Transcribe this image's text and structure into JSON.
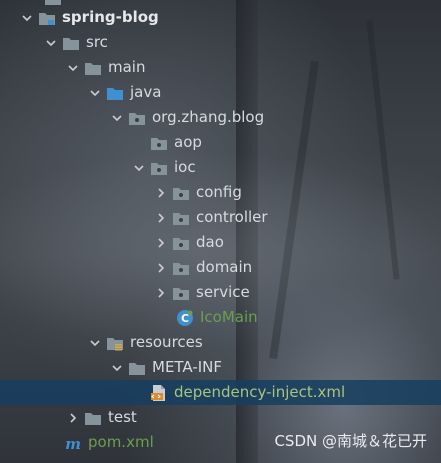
{
  "project_tree": {
    "items": [
      {
        "label": "spring-blog",
        "icon": "module-folder-icon",
        "expanded": true
      },
      {
        "label": "src",
        "icon": "folder-icon",
        "expanded": true
      },
      {
        "label": "main",
        "icon": "folder-icon",
        "expanded": true
      },
      {
        "label": "java",
        "icon": "source-root-folder-icon",
        "expanded": true
      },
      {
        "label": "org.zhang.blog",
        "icon": "package-icon",
        "expanded": true
      },
      {
        "label": "aop",
        "icon": "package-icon",
        "expanded": false
      },
      {
        "label": "ioc",
        "icon": "package-icon",
        "expanded": true
      },
      {
        "label": "config",
        "icon": "package-icon",
        "expanded": false
      },
      {
        "label": "controller",
        "icon": "package-icon",
        "expanded": false
      },
      {
        "label": "dao",
        "icon": "package-icon",
        "expanded": false
      },
      {
        "label": "domain",
        "icon": "package-icon",
        "expanded": false
      },
      {
        "label": "service",
        "icon": "package-icon",
        "expanded": false
      },
      {
        "label": "IcoMain",
        "icon": "java-class-icon"
      },
      {
        "label": "resources",
        "icon": "resources-folder-icon",
        "expanded": true
      },
      {
        "label": "META-INF",
        "icon": "folder-icon",
        "expanded": true
      },
      {
        "label": "dependency-inject.xml",
        "icon": "xml-file-icon",
        "selected": true
      },
      {
        "label": "test",
        "icon": "folder-icon",
        "expanded": false
      },
      {
        "label": "pom.xml",
        "icon": "maven-file-icon"
      }
    ]
  },
  "watermark": "CSDN @南城＆花已开",
  "colors": {
    "selection": "#163e60",
    "folder": "#87939a",
    "source_folder": "#3f8fd1",
    "class_name": "#6a9f4f",
    "text": "#d7dadf"
  }
}
